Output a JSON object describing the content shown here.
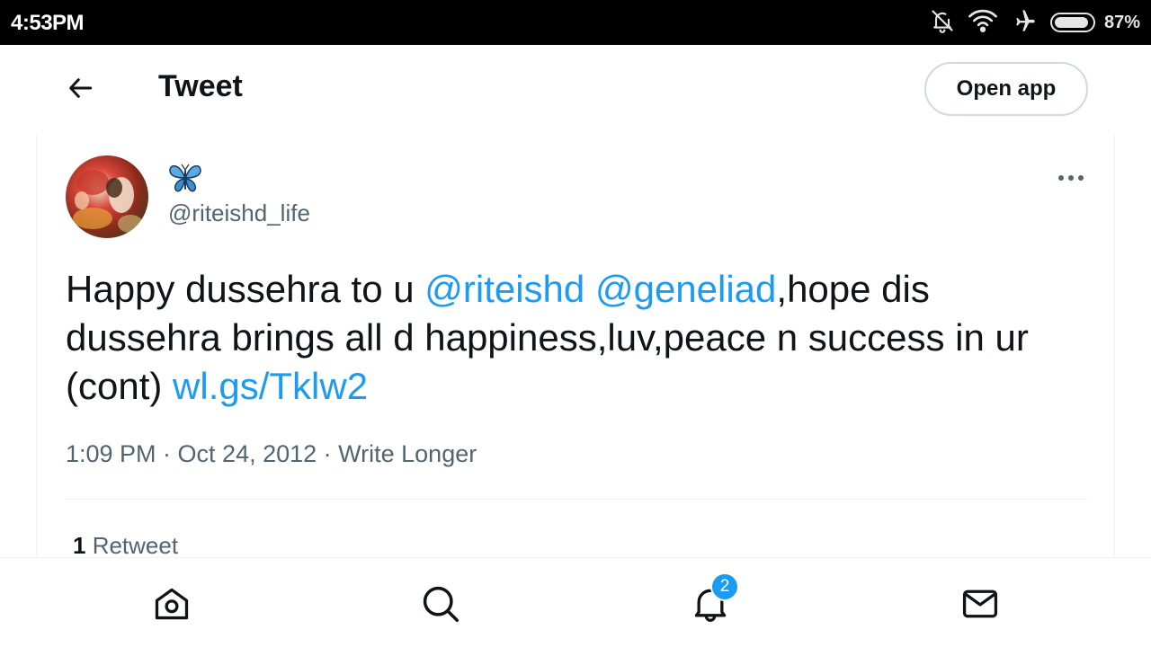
{
  "status_bar": {
    "time": "4:53PM",
    "battery_percent": "87%",
    "battery_level": 0.87,
    "icons": [
      "bell-off-icon",
      "wifi-icon",
      "airplane-mode-icon",
      "battery-icon"
    ]
  },
  "header": {
    "title": "Tweet",
    "open_app_label": "Open app",
    "back_icon": "arrow-left-icon"
  },
  "tweet": {
    "display_name_icon": "butterfly-emoji-icon",
    "handle": "@riteishd_life",
    "text": {
      "part1": "Happy dussehra to u ",
      "mention1": "@riteishd",
      "space": " ",
      "mention2": "@geneliad",
      "part2": ",hope dis dussehra brings all d happiness,luv,peace n success in ur (cont) ",
      "link": "wl.gs/Tklw2"
    },
    "meta": "1:09 PM · Oct 24, 2012 · Write Longer",
    "retweet_count": "1",
    "retweet_label": " Retweet"
  },
  "bottom_nav": {
    "items": [
      "home-icon",
      "search-icon",
      "notifications-icon",
      "messages-icon"
    ],
    "notification_badge": "2"
  },
  "colors": {
    "accent": "#1d9bf0",
    "text_primary": "#0f1419",
    "text_secondary": "#536471",
    "border": "#cfd9de"
  }
}
